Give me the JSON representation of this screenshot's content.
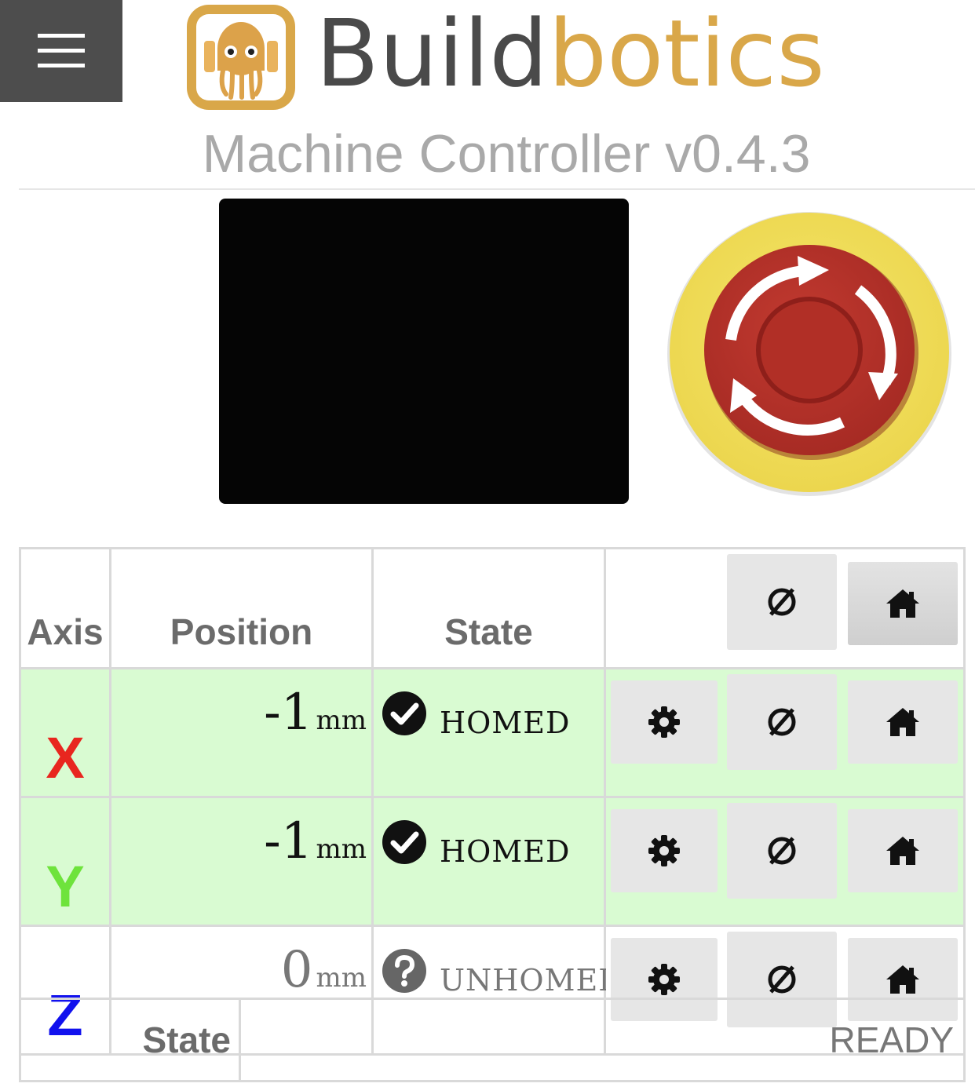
{
  "header": {
    "menu_icon": "hamburger-icon",
    "logo_icon": "buildbotics-octopus-logo",
    "logo_part1": "Build",
    "logo_part2": "botics",
    "subtitle": "Machine Controller v0.4.3",
    "colors": {
      "logo_dark": "#4a4a4a",
      "logo_gold": "#d9a749",
      "menu_bg": "#4d4d4d"
    }
  },
  "estop": {
    "icon": "emergency-stop-icon"
  },
  "axes": {
    "headers": {
      "axis": "Axis",
      "position": "Position",
      "state": "State"
    },
    "header_buttons": {
      "zero_all_icon": "zero-icon",
      "home_all_icon": "home-icon"
    },
    "rows": [
      {
        "name": "X",
        "color": "#e8261f",
        "position": "-1",
        "unit": "mm",
        "state": "HOMED",
        "state_icon": "check-circle-icon"
      },
      {
        "name": "Y",
        "color": "#6ee33c",
        "position": "-1",
        "unit": "mm",
        "state": "HOMED",
        "state_icon": "check-circle-icon"
      },
      {
        "name": "Z",
        "color": "#1111ee",
        "position": "0",
        "unit": "mm",
        "state": "UNHOMED",
        "state_icon": "question-circle-icon"
      }
    ],
    "row_buttons": [
      "gear-icon",
      "zero-icon",
      "home-icon"
    ],
    "colors": {
      "homed_bg": "#d9fbd2",
      "unhomed_bg": "#ffffff"
    }
  },
  "status": {
    "label": "State",
    "value": "READY"
  }
}
